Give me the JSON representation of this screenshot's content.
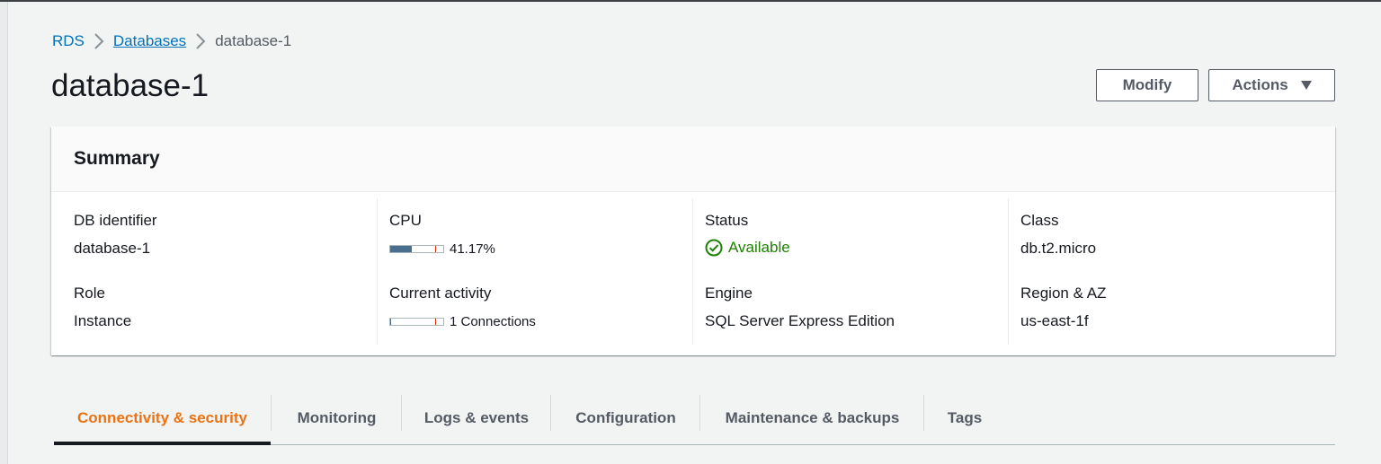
{
  "breadcrumb": {
    "items": [
      "RDS",
      "Databases",
      "database-1"
    ]
  },
  "page": {
    "title": "database-1"
  },
  "header_actions": {
    "modify_label": "Modify",
    "actions_label": "Actions"
  },
  "summary": {
    "title": "Summary",
    "db_identifier": {
      "label": "DB identifier",
      "value": "database-1"
    },
    "role": {
      "label": "Role",
      "value": "Instance"
    },
    "cpu": {
      "label": "CPU",
      "value": "41.17%",
      "percent": 41.17
    },
    "current_activity": {
      "label": "Current activity",
      "value": "1 Connections",
      "fraction": 0.02
    },
    "status": {
      "label": "Status",
      "value": "Available"
    },
    "engine": {
      "label": "Engine",
      "value": "SQL Server Express Edition"
    },
    "class": {
      "label": "Class",
      "value": "db.t2.micro"
    },
    "region": {
      "label": "Region & AZ",
      "value": "us-east-1f"
    }
  },
  "tabs": [
    {
      "label": "Connectivity & security",
      "active": true
    },
    {
      "label": "Monitoring",
      "active": false
    },
    {
      "label": "Logs & events",
      "active": false
    },
    {
      "label": "Configuration",
      "active": false
    },
    {
      "label": "Maintenance & backups",
      "active": false
    },
    {
      "label": "Tags",
      "active": false
    }
  ],
  "colors": {
    "link": "#0073bb",
    "accent": "#ec7211",
    "success": "#1d8102",
    "meter_fill": "#4a6e8d",
    "threshold": "#d13212"
  },
  "icons": {
    "separator": "chevron-right-icon",
    "status": "check-circle-icon",
    "dropdown": "caret-down-icon"
  }
}
